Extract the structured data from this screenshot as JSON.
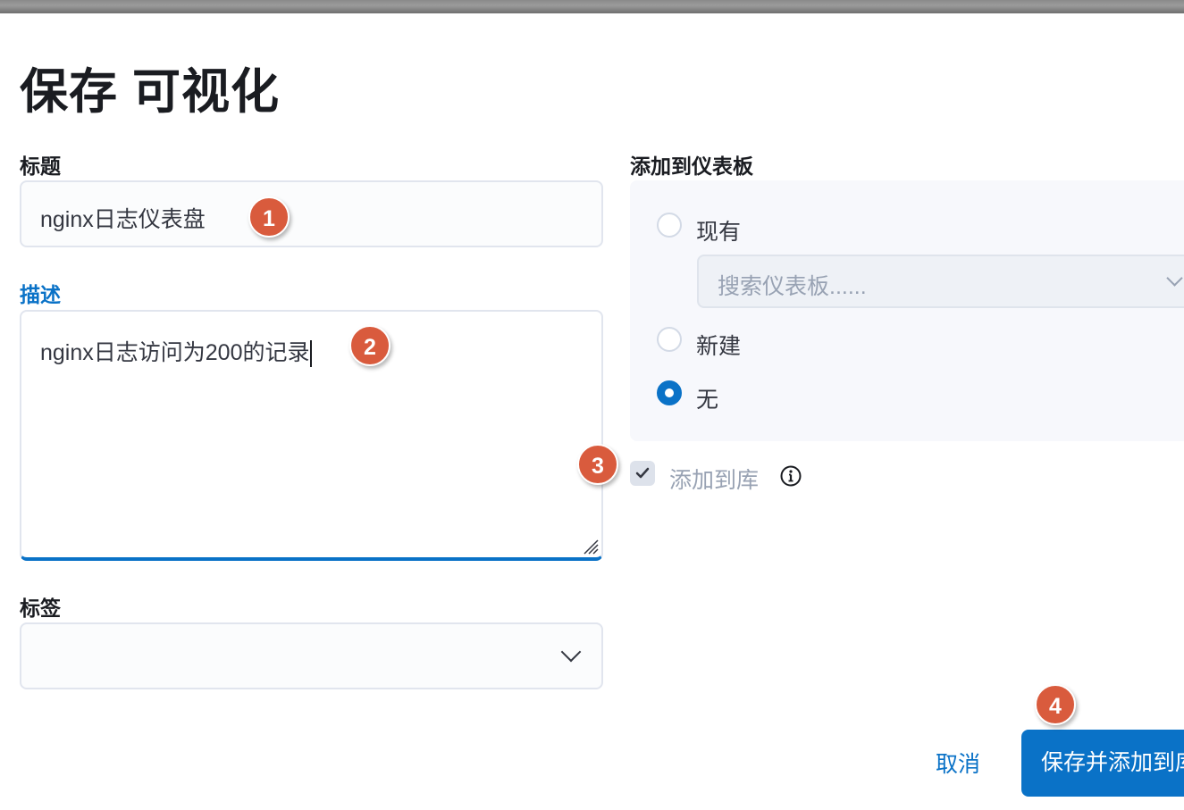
{
  "modal": {
    "title": "保存 可视化"
  },
  "form": {
    "title_label": "标题",
    "title_value": "nginx日志仪表盘",
    "description_label": "描述",
    "description_value": "nginx日志访问为200的记录",
    "tags_label": "标签",
    "tags_value": ""
  },
  "dashboard": {
    "label": "添加到仪表板",
    "options": [
      {
        "label": "现有",
        "checked": false
      },
      {
        "label": "新建",
        "checked": false
      },
      {
        "label": "无",
        "checked": true
      }
    ],
    "search_placeholder": "搜索仪表板......"
  },
  "library": {
    "label": "添加到库",
    "checked": true,
    "disabled": true
  },
  "buttons": {
    "cancel": "取消",
    "save": "保存并添加到库"
  },
  "steps": [
    "1",
    "2",
    "3",
    "4"
  ],
  "colors": {
    "accent": "#0a72c7",
    "step_badge": "#d95b3d"
  },
  "icons": [
    "chevron-down-icon",
    "check-icon",
    "info-icon",
    "resize-grip-icon"
  ]
}
